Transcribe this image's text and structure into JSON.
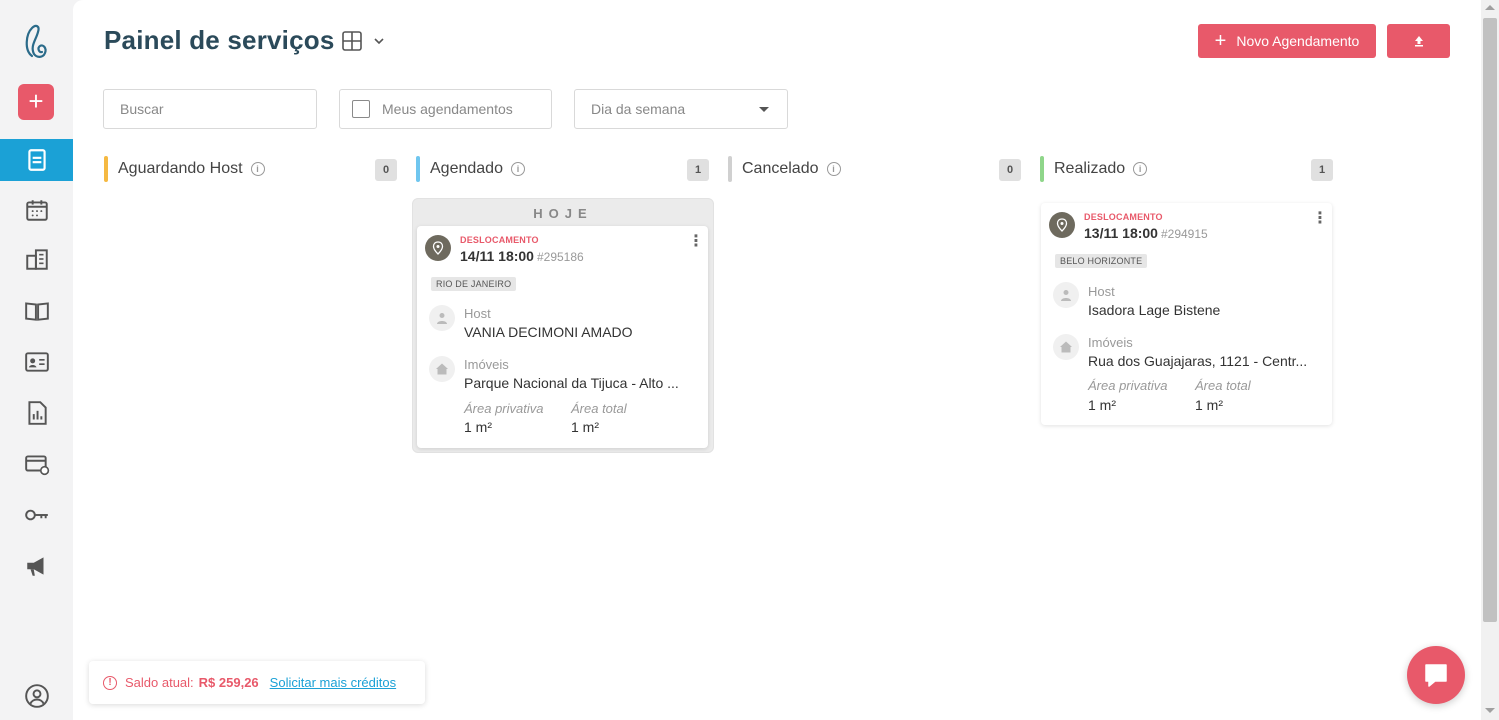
{
  "page": {
    "title": "Painel de serviços"
  },
  "actions": {
    "new_label": "Novo Agendamento"
  },
  "filters": {
    "search_placeholder": "Buscar",
    "my_schedules_label": "Meus agendamentos",
    "weekday_label": "Dia da semana"
  },
  "columns": [
    {
      "title": "Aguardando Host",
      "count": "0",
      "color": "#f5b942"
    },
    {
      "title": "Agendado",
      "count": "1",
      "color": "#6fc6ef"
    },
    {
      "title": "Cancelado",
      "count": "0",
      "color": "#d0d0d0"
    },
    {
      "title": "Realizado",
      "count": "1",
      "color": "#8fd68a"
    }
  ],
  "today_label": "HOJE",
  "cards": [
    {
      "type": "DESLOCAMENTO",
      "date": "14/11 18:00",
      "id": "#295186",
      "city": "RIO DE JANEIRO",
      "host_label": "Host",
      "host": "VANIA DECIMONI AMADO",
      "property_label": "Imóveis",
      "property": "Parque Nacional da Tijuca - Alto ...",
      "private_area_label": "Área privativa",
      "private_area": "1 m²",
      "total_area_label": "Área total",
      "total_area": "1 m²"
    },
    {
      "type": "DESLOCAMENTO",
      "date": "13/11 18:00",
      "id": "#294915",
      "city": "BELO HORIZONTE",
      "host_label": "Host",
      "host": "Isadora Lage Bistene",
      "property_label": "Imóveis",
      "property": "Rua dos Guajajaras, 1121 - Centr...",
      "private_area_label": "Área privativa",
      "private_area": "1 m²",
      "total_area_label": "Área total",
      "total_area": "1 m²"
    }
  ],
  "balance": {
    "label": "Saldo atual:",
    "value": "R$ 259,26",
    "link": "Solicitar mais créditos"
  },
  "colors": {
    "accent": "#e8596a",
    "active_nav": "#1ba1d6",
    "title": "#2b4a5a"
  }
}
